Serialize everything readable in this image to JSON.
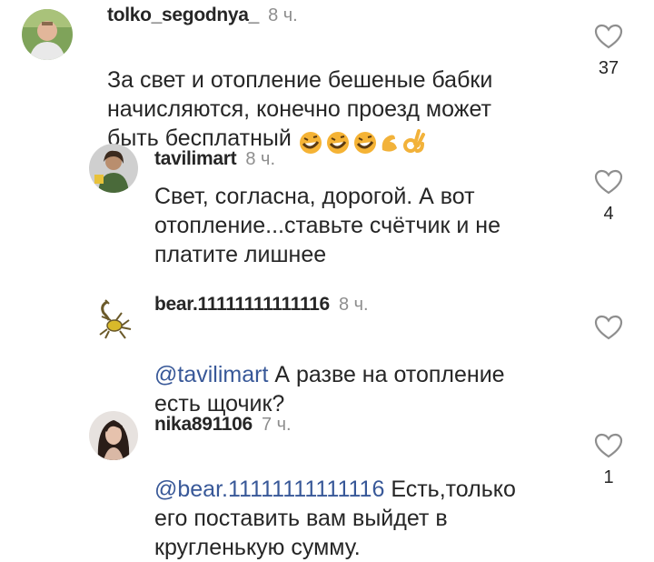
{
  "comments": [
    {
      "username": "tolko_segodnya_",
      "time": "8 ч.",
      "text": "За свет и отопление бешеные бабки\nначисляются, конечно проезд может\nбыть бесплатный",
      "emoji_icons": [
        "rofl-emoji",
        "rofl-emoji",
        "rofl-emoji",
        "flexed-biceps-emoji",
        "ok-hand-emoji"
      ],
      "likes": "37"
    },
    {
      "username": "tavilimart",
      "time": "8 ч.",
      "text": "Свет, согласна, дорогой. А вот\nотопление...ставьте счётчик и не\nплатите лишнее",
      "likes": "4"
    },
    {
      "username": "bear.11111111111116",
      "time": "8 ч.",
      "mention": "@tavilimart",
      "text": " А разве на отопление\nесть щочик?",
      "likes": ""
    },
    {
      "username": "nika891106",
      "time": "7 ч.",
      "mention": "@bear.11111111111116",
      "text": " Есть,только\nего поставить вам выйдет в\nкругленькую сумму.",
      "likes": "1"
    }
  ],
  "icons": {
    "like": "heart-outline-icon"
  },
  "colors": {
    "mention": "#385898",
    "meta": "#8e8e8e",
    "text": "#262626"
  }
}
